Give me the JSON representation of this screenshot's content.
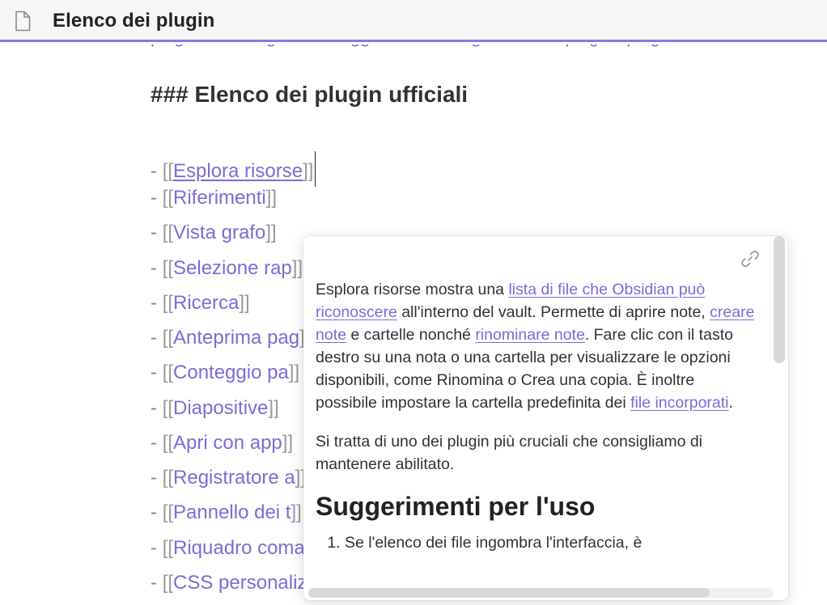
{
  "tab": {
    "title": "Elenco dei plugin",
    "icon": "file-icon"
  },
  "editor": {
    "heading": "### Elenco dei plugin ufficiali",
    "list_prefix": "- [[",
    "list_suffix": "]]",
    "items": [
      {
        "full": "Esplora risorse",
        "visible": "Esplora risorse"
      },
      {
        "full": "Riferimenti",
        "visible": "Riferimenti"
      },
      {
        "full": "Vista grafo",
        "visible": "Vista grafo"
      },
      {
        "full": "Selezione rapida",
        "visible": "Selezione rap"
      },
      {
        "full": "Ricerca",
        "visible": "Ricerca"
      },
      {
        "full": "Anteprima pagina",
        "visible": "Anteprima pag"
      },
      {
        "full": "Conteggio parole",
        "visible": "Conteggio pa"
      },
      {
        "full": "Diapositive",
        "visible": "Diapositive"
      },
      {
        "full": "Apri con app predefinita",
        "visible": "Apri con app"
      },
      {
        "full": "Registratore audio",
        "visible": "Registratore a"
      },
      {
        "full": "Pannello dei tag",
        "visible": "Pannello dei t"
      },
      {
        "full": "Riquadro comandi",
        "visible": "Riquadro comandi"
      },
      {
        "full": "CSS personalizzati",
        "visible": "CSS personalizzati"
      }
    ]
  },
  "popover": {
    "link_icon": "link-icon",
    "para1": {
      "t1": "Esplora risorse mostra una ",
      "l1": "lista di file che Obsidian può riconoscere",
      "t2": " all'interno del vault. Permette di aprire note, ",
      "l2": "creare note",
      "t3": " e cartelle nonché ",
      "l3": "rinominare note",
      "t4": ". Fare clic con il tasto destro su una nota o una cartella per visualizzare le opzioni disponibili, come Rinomina o Crea una copia. È inoltre possibile impostare la cartella predefinita dei ",
      "l4": "file incorporati",
      "t5": "."
    },
    "para2": "Si tratta di uno dei plugin più cruciali che consigliamo di mantenere abilitato.",
    "h2": "Suggerimenti per l'uso",
    "ol_first": "Se l'elenco dei file ingombra l'interfaccia, è"
  }
}
